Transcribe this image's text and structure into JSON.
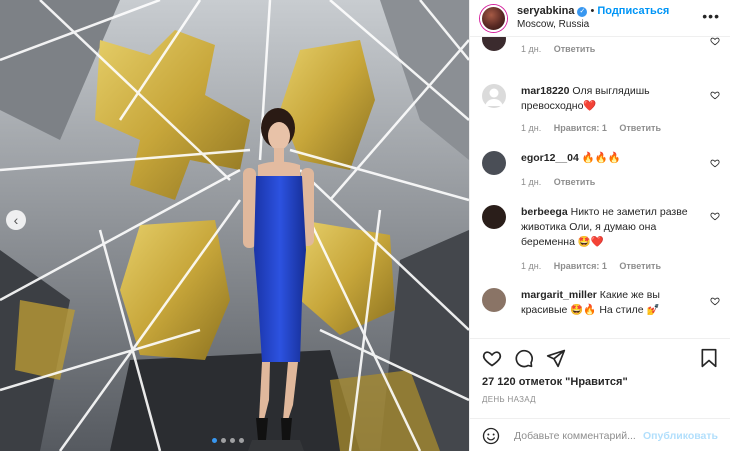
{
  "post": {
    "username": "seryabkina",
    "separator": "•",
    "follow_label": "Подписаться",
    "location": "Moscow, Russia",
    "more_label": "•••"
  },
  "photo": {
    "prev_arrow": "‹",
    "carousel_dots": 4,
    "active_dot": 0
  },
  "comments": [
    {
      "username": "",
      "text": "",
      "time": "1 дн.",
      "likes": "",
      "reply_label": "Ответить",
      "avatar_color": "#3b2b2e",
      "has_heart": true
    },
    {
      "username": "mar18220",
      "text": "Оля выглядишь превосходно❤️",
      "time": "1 дн.",
      "likes": "Нравится: 1",
      "reply_label": "Ответить",
      "avatar_color": "#dbdbdb",
      "has_heart": true
    },
    {
      "username": "egor12__04",
      "text": "🔥🔥🔥",
      "time": "1 дн.",
      "likes": "",
      "reply_label": "Ответить",
      "avatar_color": "#4a4e56",
      "has_heart": true
    },
    {
      "username": "berbeega",
      "text": "Никто не заметил разве животика Оли, я думаю она беременна 🤩❤️",
      "time": "1 дн.",
      "likes": "Нравится: 1",
      "reply_label": "Ответить",
      "avatar_color": "#2a1e1a",
      "has_heart": true
    },
    {
      "username": "margarit_miller",
      "text": "Какие же вы красивые 🤩🔥 На стиле 💅",
      "time": "",
      "likes": "",
      "reply_label": "",
      "avatar_color": "#8a7466",
      "has_heart": true
    }
  ],
  "actions": {
    "likes_text": "27 120 отметок \"Нравится\"",
    "date_text": "ДЕНЬ НАЗАД",
    "comment_placeholder": "Добавьте комментарий...",
    "publish_label": "Опубликовать"
  },
  "colors": {
    "accent": "#0095f6",
    "verified": "#3897f0",
    "dress": "#1d3fc4",
    "heart_red": "#ed4956",
    "muted": "#8e8e8e"
  }
}
